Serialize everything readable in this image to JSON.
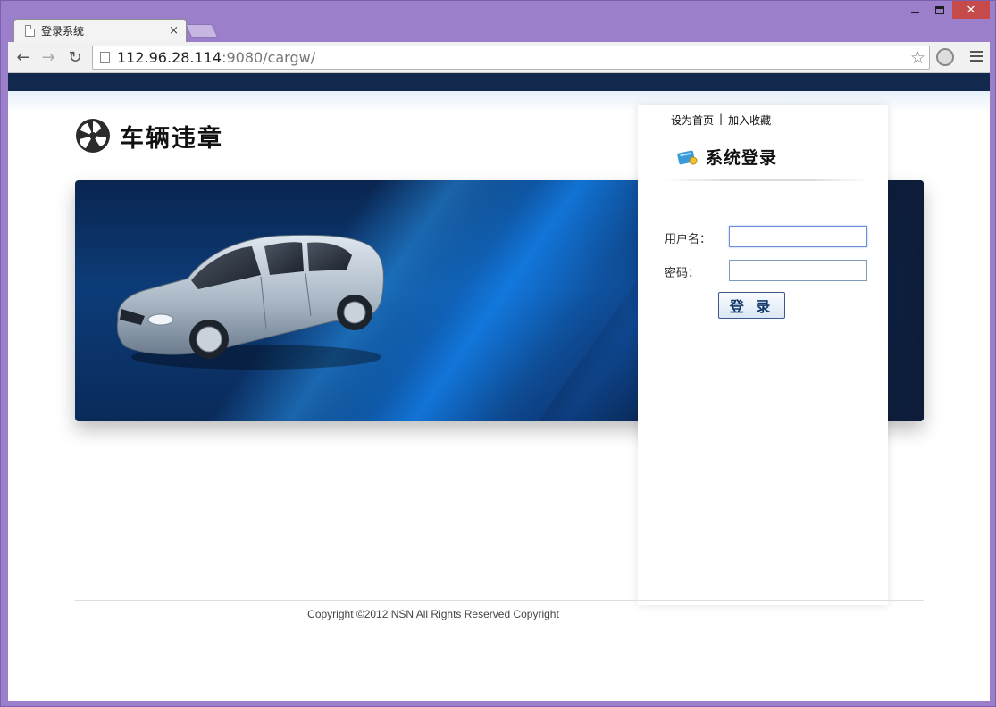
{
  "browser": {
    "tab_title": "登录系统",
    "url_host": "112.96.28.114",
    "url_rest": ":9080/cargw/"
  },
  "site": {
    "logo_text": "车辆违章"
  },
  "login": {
    "link_homepage": "设为首页",
    "link_separator": "|",
    "link_favorite": "加入收藏",
    "heading": "系统登录",
    "username_label": "用户名：",
    "password_label": "密码：",
    "username_value": "",
    "password_value": "",
    "submit_label": "登 录"
  },
  "footer": {
    "copyright": "Copyright ©2012 NSN All Rights Reserved Copyright"
  },
  "colors": {
    "top_bar": "#13284d",
    "banner_blue": "#0c3c78",
    "window_frame": "#9b7fca",
    "close_button": "#c74a4a"
  }
}
